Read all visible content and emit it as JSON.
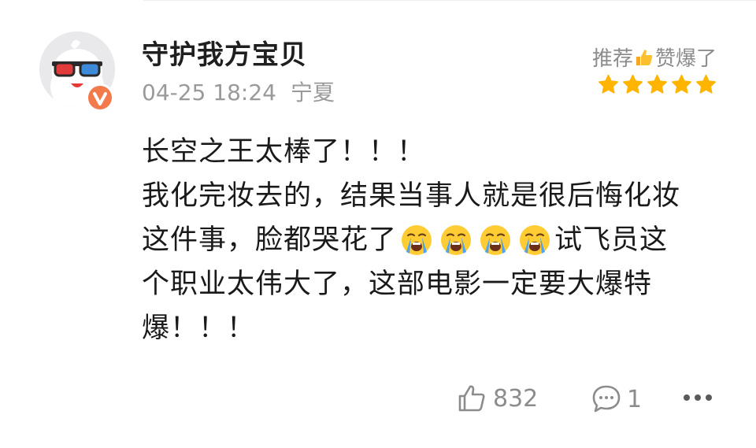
{
  "user": {
    "name": "守护我方宝贝",
    "date": "04-25 18:24",
    "location": "宁夏"
  },
  "rating": {
    "label_before": "推荐",
    "label_after": "赞爆了",
    "stars": 5,
    "star_color": "#ffb400"
  },
  "comment": {
    "line1": "长空之王太棒了！！！",
    "line2": "我化完妆去的，结果当事人就是很后悔化妆",
    "line3_before": "这件事，脸都哭花了",
    "line3_after": "试飞员这",
    "line4": "个职业太伟大了，这部电影一定要大爆特",
    "line5": "爆！！！",
    "emoji_icon": "loudly-crying-face-icon"
  },
  "actions": {
    "like_count": "832",
    "reply_count": "1"
  }
}
